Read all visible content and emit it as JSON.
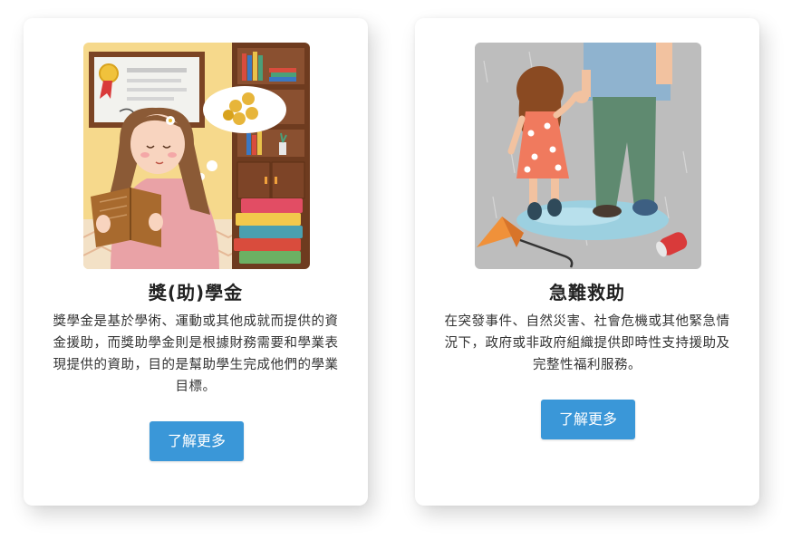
{
  "cards": [
    {
      "title": "獎(助)學金",
      "description": "獎學金是基於學術、運動或其他成就而提供的資金援助，而獎助學金則是根據財務需要和學業表現提供的資助，目的是幫助學生完成他們的學業目標。",
      "button_label": "了解更多",
      "illustration": "girl-reading-book-with-coins-thought-bubble"
    },
    {
      "title": "急難救助",
      "description": "在突發事件、自然災害、社會危機或其他緊急情況下，政府或非政府組織提供即時性支持援助及完整性福利服務。",
      "button_label": "了解更多",
      "illustration": "child-holding-adult-hand-in-rain"
    }
  ],
  "colors": {
    "button": "#3a97d8",
    "card_background": "#ffffff"
  }
}
